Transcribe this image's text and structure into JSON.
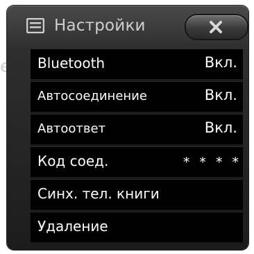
{
  "header": {
    "title": "Настройки",
    "menu_icon": "list-icon",
    "close_icon": "close-icon"
  },
  "items": [
    {
      "label": "Bluetooth",
      "value": "Вкл."
    },
    {
      "label": "Автосоединение",
      "value": "Вкл."
    },
    {
      "label": "Автоответ",
      "value": "Вкл."
    },
    {
      "label": "Код соед.",
      "value": "* * * *"
    },
    {
      "label": "Синх. тел. книги",
      "value": ""
    },
    {
      "label": "Удаление",
      "value": ""
    }
  ],
  "colors": {
    "panel": "#1c1c1c",
    "row": "#000000",
    "text": "#ffffff",
    "header_text": "#cfcfcf"
  }
}
